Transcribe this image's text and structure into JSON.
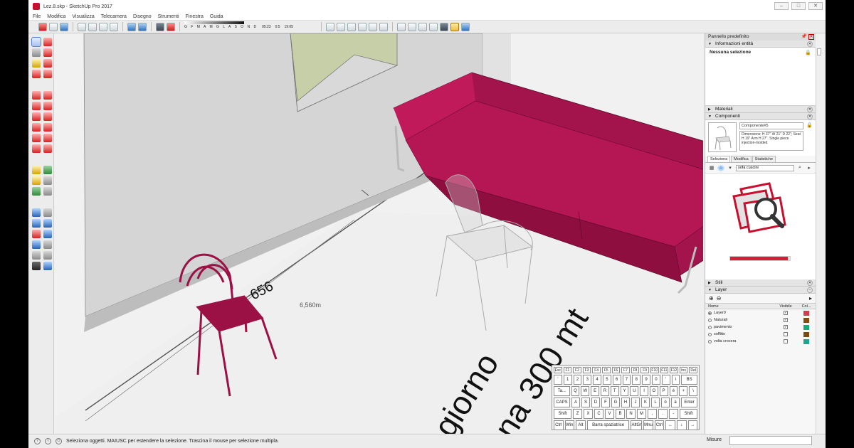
{
  "window": {
    "title": "Lez.8.skp - SketchUp Pro 2017",
    "controls": [
      "–",
      "□",
      "✕"
    ]
  },
  "menu": [
    "File",
    "Modifica",
    "Visualizza",
    "Telecamera",
    "Disegno",
    "Strumenti",
    "Finestra",
    "Guida"
  ],
  "shadow": {
    "months": "G F M A M G L A S O N D",
    "time_start": "05:23",
    "time_mid": "0:5",
    "time_end": "19:05"
  },
  "viewport": {
    "dimension_label": "6,560m",
    "dimension_text": "656",
    "floor_text_1": "giorno",
    "floor_text_2": "na 300 mt"
  },
  "keyboard": {
    "rows": [
      [
        "Esc",
        "F1",
        "F2",
        "F3",
        "F4",
        "F5",
        "F6",
        "F7",
        "F8",
        "F9",
        "F10",
        "F11",
        "F12",
        "Ins",
        "Del"
      ],
      [
        "'",
        "1",
        "2",
        "3",
        "4",
        "5",
        "6",
        "7",
        "8",
        "9",
        "0",
        "'",
        "ì",
        "BS"
      ],
      [
        "Ta...",
        "Q",
        "W",
        "E",
        "R",
        "T",
        "Y",
        "U",
        "I",
        "O",
        "P",
        "è",
        "+",
        "\\"
      ],
      [
        "CAPS",
        "A",
        "S",
        "D",
        "F",
        "G",
        "H",
        "J",
        "K",
        "L",
        "ò",
        "à",
        "Enter"
      ],
      [
        "Shift",
        "Z",
        "X",
        "C",
        "V",
        "B",
        "N",
        "M",
        ",",
        ".",
        "-",
        "Shift"
      ],
      [
        "Ctrl",
        "Win",
        "Alt",
        "Barra spaziatrice",
        "AltGr",
        "Mnu",
        "Ctrl",
        "←",
        "↓",
        "→"
      ]
    ]
  },
  "panel": {
    "title": "Pannello predefinito",
    "entity_info": {
      "header": "Informazioni entità",
      "value": "Nessuna selezione"
    },
    "materials_header": "Materiali",
    "components": {
      "header": "Componenti",
      "name": "Componente#5",
      "description": "Dimensions: H 37\" W 21\" D 22\"; Seat H 19\" Arm H 27\". Single piece injection-molded",
      "tabs": [
        "Seleziona",
        "Modifica",
        "Statistiche"
      ],
      "search_value": "sofa cuscini",
      "loading_progress": 0.97
    },
    "styles_header": "Stili",
    "layers": {
      "header": "Layer",
      "columns": [
        "Nome",
        "Visibile",
        "Col..."
      ],
      "rows": [
        {
          "name": "Layer0",
          "active": true,
          "visible": true,
          "color": "#d83a4b"
        },
        {
          "name": "Naturali",
          "active": false,
          "visible": true,
          "color": "#8a4b0f"
        },
        {
          "name": "pavimento",
          "active": false,
          "visible": true,
          "color": "#1aa87a"
        },
        {
          "name": "soffitto",
          "active": false,
          "visible": false,
          "color": "#7a4a10"
        },
        {
          "name": "volta crocera",
          "active": false,
          "visible": false,
          "color": "#1aa890"
        }
      ]
    }
  },
  "status": {
    "message": "Seleziona oggetti. MAIUSC per estendere la selezione. Trascina il mouse per selezione multipla.",
    "measures_label": "Misure"
  }
}
